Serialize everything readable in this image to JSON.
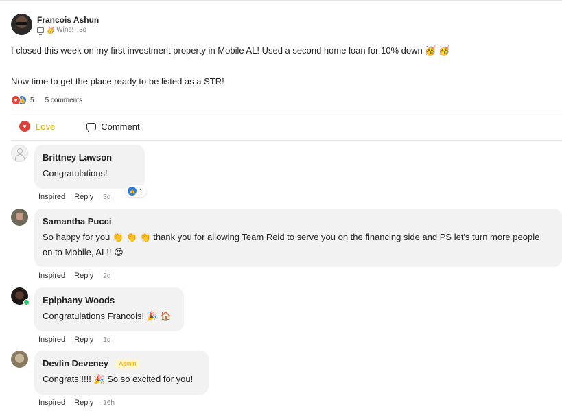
{
  "post": {
    "author": "Francois Ashun",
    "category_emoji": "🥳",
    "category": "Wins!",
    "time": "3d",
    "paragraphs": [
      "I closed this week on my first investment property in Mobile AL! Used a second home loan for 10% down 🥳 🥳",
      "Now time to get the place ready to be listed as a STR!"
    ],
    "reaction_count": "5",
    "comments_count": "5 comments"
  },
  "actions": {
    "love": "Love",
    "comment": "Comment"
  },
  "comments": [
    {
      "name": "Brittney Lawson",
      "text": "Congratulations!",
      "inspired": "Inspired",
      "reply": "Reply",
      "time": "3d",
      "likes": "1"
    },
    {
      "name": "Samantha Pucci",
      "text": "So happy for you 👏 👏 👏 thank you for allowing Team Reid to serve you on the financing side and PS let's turn more people on to Mobile, AL!! 😍",
      "inspired": "Inspired",
      "reply": "Reply",
      "time": "2d"
    },
    {
      "name": "Epiphany Woods",
      "text": "Congratulations Francois! 🎉 🏠",
      "inspired": "Inspired",
      "reply": "Reply",
      "time": "1d"
    },
    {
      "name": "Devlin Deveney",
      "badge": "Admin",
      "text": "Congrats!!!!! 🎉 So so excited for you!",
      "inspired": "Inspired",
      "reply": "Reply",
      "time": "16h"
    }
  ],
  "colors": {
    "love_accent": "#e6b80f",
    "heart_red": "#d9413a",
    "like_blue": "#2f7de1",
    "bubble_bg": "#f2f2f2",
    "online_green": "#2ec26a"
  }
}
